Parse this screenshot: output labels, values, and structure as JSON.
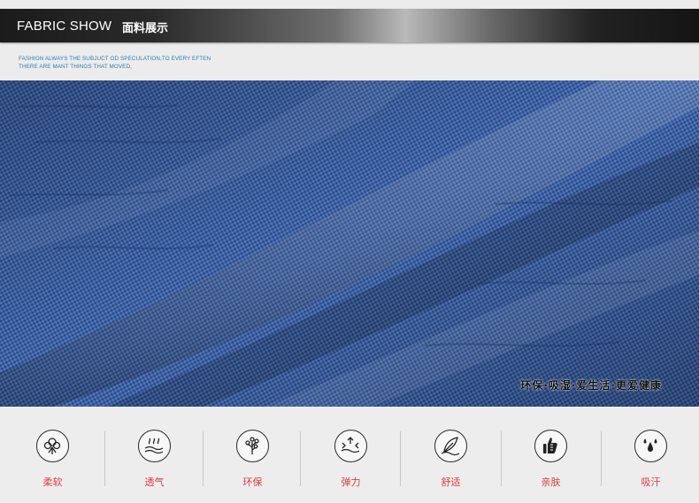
{
  "header": {
    "title": "FABRIC SHOW",
    "title_cn": "面料展示"
  },
  "subtitle": "FASHION ALWAYS THE  SUBJUCT OD SPECULATION,TO EVERY EFTEN THERE ARE MANT THINGS THAT MOVED,",
  "fabric": {
    "image": "blue-knit-fabric-folds",
    "slogan": "环保·吸湿·爱生活·更爱健康"
  },
  "features": [
    {
      "icon": "cotton-icon",
      "label": "柔软"
    },
    {
      "icon": "breathable-icon",
      "label": "透气"
    },
    {
      "icon": "tree-icon",
      "label": "环保"
    },
    {
      "icon": "stretch-icon",
      "label": "弹力"
    },
    {
      "icon": "feather-icon",
      "label": "舒适"
    },
    {
      "icon": "thumb-icon",
      "label": "亲肤"
    },
    {
      "icon": "absorb-icon",
      "label": "吸汗"
    }
  ],
  "colors": {
    "accent_label": "#e23b3b",
    "subtitle_blue": "#2a7ab8",
    "fabric_blue": "#3e63a6"
  }
}
